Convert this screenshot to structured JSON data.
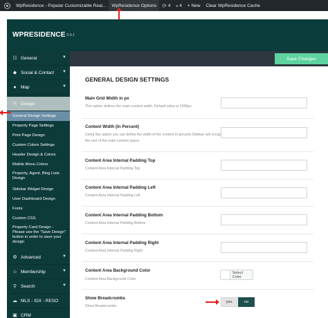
{
  "adminbar": {
    "site_name": "WpResidence - Popular Customizable Real...",
    "options_link": "WpResidence Options",
    "updates_count": "4",
    "comments_count": "4",
    "new_label": "+ New",
    "clear_cache": "Clear WpResidence Cache"
  },
  "brand": {
    "name": "WPRESIDENCE",
    "version": "3.9.1"
  },
  "toolbar": {
    "save_label": "Save Changes"
  },
  "sidebar": {
    "top_items": [
      {
        "label": "General",
        "icon": "sliders-icon"
      },
      {
        "label": "Social & Contact",
        "icon": "share-icon"
      },
      {
        "label": "Map",
        "icon": "map-pin-icon"
      }
    ],
    "design": {
      "label": "Design",
      "icon": "brush-icon"
    },
    "sub_items": [
      "General Design Settings",
      "Property Page Settings",
      "Print Page Design",
      "Custom Colors Settings",
      "Header Design & Colors",
      "Mobile Menu Colors",
      "Property, Agent, Blog Lists Design",
      "Sidebar Widget Design",
      "User Dashboard Design",
      "Fonts",
      "Custom CSS",
      "Property Card Design - Please use the \"Save Design\" button in order to save your design"
    ],
    "bottom_items": [
      {
        "label": "Advanced",
        "icon": "gear-icon"
      },
      {
        "label": "Membership",
        "icon": "users-icon"
      },
      {
        "label": "Search",
        "icon": "search-icon"
      },
      {
        "label": "MLS - IDX - RESO",
        "icon": "cloud-icon"
      },
      {
        "label": "CRM",
        "icon": "crm-icon"
      }
    ]
  },
  "main": {
    "title": "GENERAL DESIGN SETTINGS",
    "options": [
      {
        "title": "Main Grid Width in px",
        "desc": "This option defines the main content width. Default value is 1200px"
      },
      {
        "title": "Content Width (In Percent)",
        "desc": "Using this option you can define the width of the content in percent.Sidebar will occupy the rest of the main content space."
      },
      {
        "title": "Content Area Internal Padding Top",
        "desc": "Content Area Internal Padding Top"
      },
      {
        "title": "Content Area Internal Padding Left",
        "desc": "Content Area Internal Padding Left"
      },
      {
        "title": "Content Area Internal Padding Bottom",
        "desc": "Content Area Internal Padding Bottom"
      },
      {
        "title": "Content Area Internal Padding Right",
        "desc": "Content Area Internal Padding Right"
      },
      {
        "title": "Content Area Background Color",
        "desc": "Content Area Background Color"
      },
      {
        "title": "Show Breadcrumbs",
        "desc": "Show Breadcrumbs"
      }
    ],
    "color_button": "Select Color",
    "breadcrumbs_yes": "yes",
    "breadcrumbs_no": "no"
  },
  "colors": {
    "accent": "#5ed39f",
    "sidebar": "#0d3b3a",
    "active_sub": "#6c8fa8"
  }
}
